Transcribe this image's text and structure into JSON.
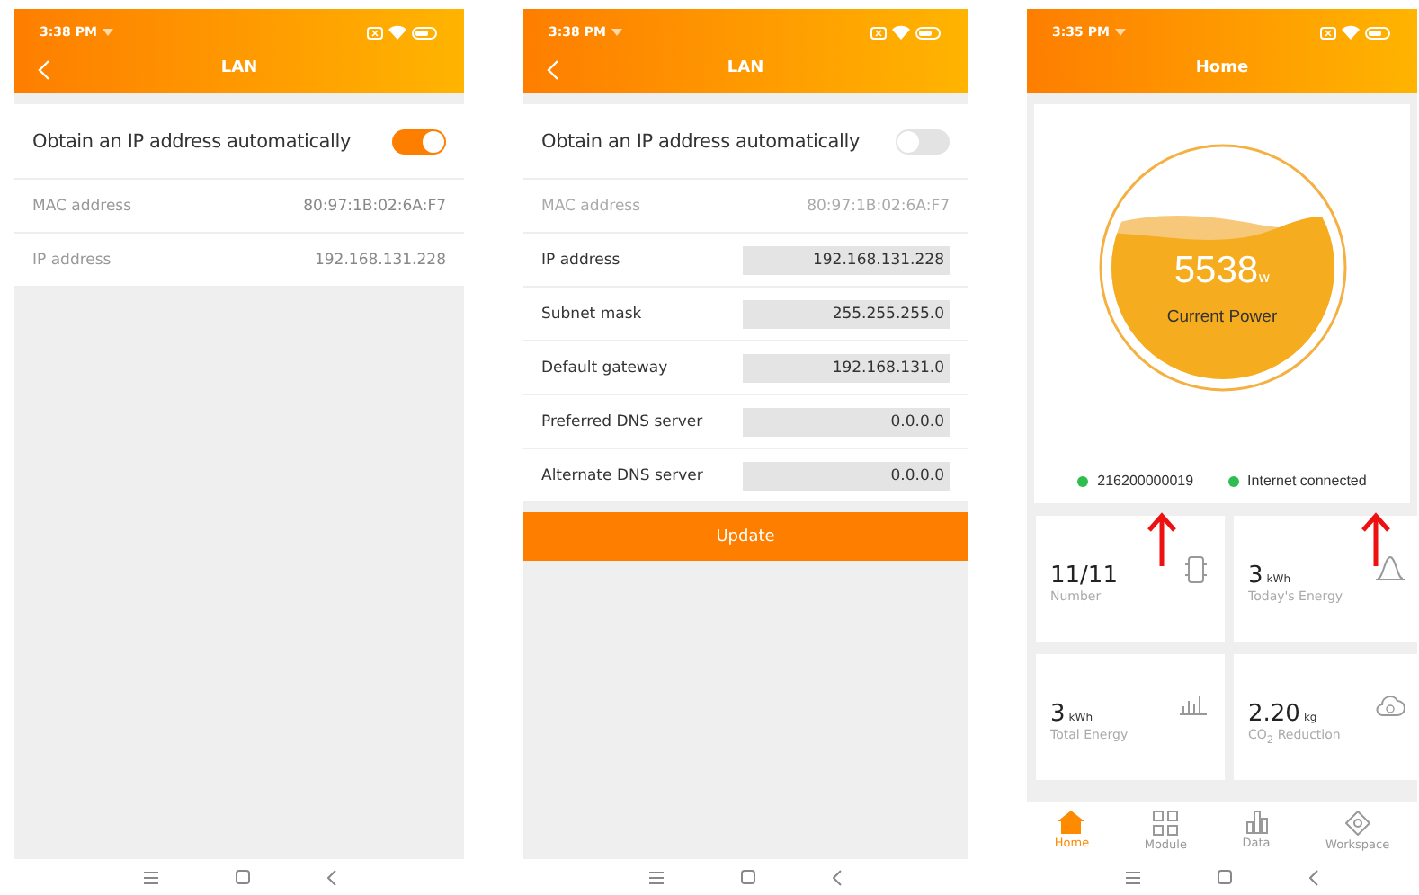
{
  "screens": [
    {
      "kind": "lan",
      "status_time": "3:38 PM",
      "title": "LAN",
      "auto_ip": {
        "label": "Obtain an IP address automatically",
        "on": true
      },
      "rows": [
        {
          "label": "MAC address",
          "value": "80:97:1B:02:6A:F7",
          "editable": false
        },
        {
          "label": "IP address",
          "value": "192.168.131.228",
          "editable": false
        }
      ]
    },
    {
      "kind": "lan",
      "status_time": "3:38 PM",
      "title": "LAN",
      "auto_ip": {
        "label": "Obtain an IP address automatically",
        "on": false
      },
      "rows": [
        {
          "label": "MAC address",
          "value": "80:97:1B:02:6A:F7",
          "editable": false
        },
        {
          "label": "IP address",
          "value": "192.168.131.228",
          "editable": true
        },
        {
          "label": "Subnet mask",
          "value": "255.255.255.0",
          "editable": true
        },
        {
          "label": "Default gateway",
          "value": "192.168.131.0",
          "editable": true
        },
        {
          "label": "Preferred DNS server",
          "value": "0.0.0.0",
          "editable": true
        },
        {
          "label": "Alternate DNS server",
          "value": "0.0.0.0",
          "editable": true
        }
      ],
      "button": "Update"
    },
    {
      "kind": "home",
      "status_time": "3:35 PM",
      "title": "Home",
      "power": {
        "value": "5538",
        "unit": "w",
        "label": "Current Power"
      },
      "statuses": [
        {
          "text": "216200000019",
          "color": "#2ebd4e"
        },
        {
          "text": "Internet connected",
          "color": "#2ebd4e"
        }
      ],
      "cards": [
        {
          "kind": "chip",
          "value": "11/11",
          "label": "Number"
        },
        {
          "kind": "curve",
          "value": "3",
          "unit": "kWh",
          "label": "Today's Energy"
        },
        {
          "kind": "bars",
          "value": "3",
          "unit": "kWh",
          "label": "Total Energy"
        },
        {
          "kind": "cloud",
          "value": "2.20",
          "unit": "kg",
          "label": "CO$_{2}$ Reduction"
        }
      ],
      "tabs": [
        {
          "kind": "home",
          "label": "Home",
          "selected": true
        },
        {
          "kind": "grid",
          "label": "Module",
          "selected": false
        },
        {
          "kind": "chart",
          "label": "Data",
          "selected": false
        },
        {
          "kind": "workspace",
          "label": "Workspace",
          "selected": false
        }
      ]
    }
  ]
}
